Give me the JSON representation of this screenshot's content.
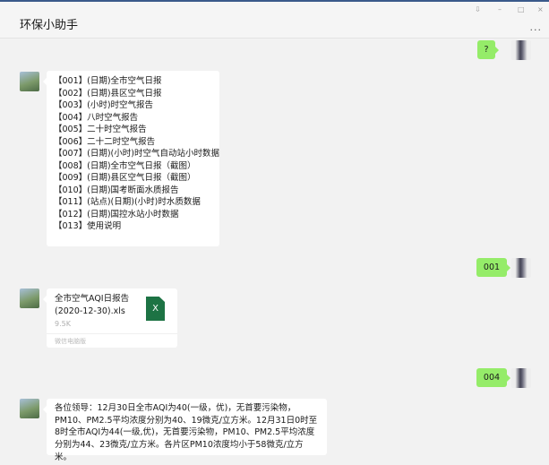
{
  "window": {
    "title": "环保小助手",
    "controls": {
      "pin": "⇩",
      "minimize": "–",
      "maximize": "□",
      "close": "×"
    },
    "more": "..."
  },
  "messages": [
    {
      "from": "me",
      "text": "?"
    },
    {
      "from": "bot",
      "menu": [
        "【001】(日期)全市空气日报",
        "【002】(日期)县区空气日报",
        "【003】(小时)时空气报告",
        "【004】八时空气报告",
        "【005】二十时空气报告",
        "【006】二十二时空气报告",
        "【007】(日期)(小时)时空气自动站小时数据",
        "【008】(日期)全市空气日报（截图）",
        "【009】(日期)县区空气日报（截图）",
        "【010】(日期)国考断面水质报告",
        "【011】(站点)(日期)(小时)时水质数据",
        "【012】(日期)国控水站小时数据",
        "【013】使用说明"
      ]
    },
    {
      "from": "me",
      "text": "001"
    },
    {
      "from": "bot",
      "file": {
        "name": "全市空气AQI日报告(2020-12-30).xls",
        "size": "9.5K",
        "source": "微信电脑版",
        "icon_label": "X"
      }
    },
    {
      "from": "me",
      "text": "004"
    },
    {
      "from": "bot",
      "text": "各位领导：12月30日全市AQI为40(一级，优)，无首要污染物，PM10、PM2.5平均浓度分别为40、19微克/立方米。12月31日0时至8时全市AQI为44(一级,优)，无首要污染物，PM10、PM2.5平均浓度分别为44、23微克/立方米。各片区PM10浓度均小于58微克/立方米。"
    }
  ]
}
